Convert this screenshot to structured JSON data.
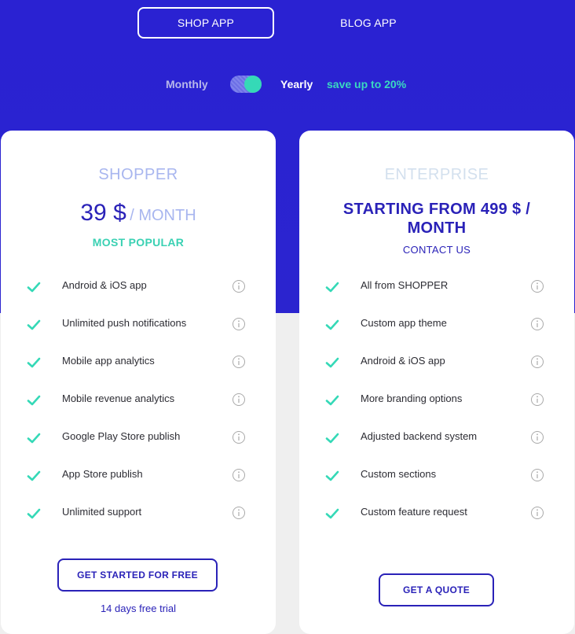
{
  "tabs": {
    "shop": "SHOP APP",
    "blog": "BLOG APP"
  },
  "billing": {
    "monthly": "Monthly",
    "yearly": "Yearly",
    "save": "save up to 20%",
    "yearly_selected": true
  },
  "colors": {
    "brand_blue": "#2a22d2",
    "accent_teal": "#35d9b7",
    "text_dark": "#2c2c33",
    "button_blue": "#2a22b8"
  },
  "plans": [
    {
      "name": "SHOPPER",
      "price": "39 $",
      "period": "/ MONTH",
      "badge": "MOST POPULAR",
      "features": [
        "Android & iOS app",
        "Unlimited push notifications",
        "Mobile app analytics",
        "Mobile revenue analytics",
        "Google Play Store publish",
        "App Store publish",
        "Unlimited support"
      ],
      "cta": "GET STARTED FOR FREE",
      "note": "14 days free trial"
    },
    {
      "name": "ENTERPRISE",
      "price": "STARTING FROM 499 $ / MONTH",
      "contact": "CONTACT US",
      "features": [
        "All from SHOPPER",
        "Custom app theme",
        "Android & iOS app",
        "More branding options",
        "Adjusted backend system",
        "Custom sections",
        "Custom feature request"
      ],
      "cta": "GET A QUOTE"
    }
  ],
  "icons": {
    "check": "check-icon",
    "info": "info-icon"
  }
}
